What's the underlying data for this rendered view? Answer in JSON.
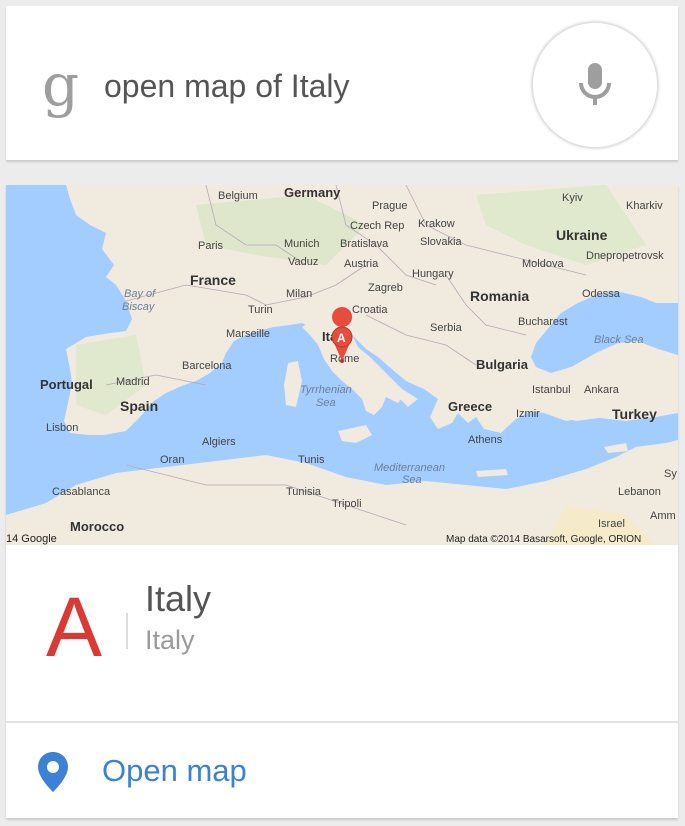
{
  "search": {
    "logo_letter": "g",
    "query": "open map of Italy",
    "mic_icon": "microphone-icon"
  },
  "map": {
    "labels": {
      "germany": "Germany",
      "belgium": "Belgium",
      "prague": "Prague",
      "kyiv": "Kyiv",
      "kharkiv": "Kharkiv",
      "czech_rep": "Czech Rep",
      "krakow": "Krakow",
      "paris": "Paris",
      "munich": "Munich",
      "bratislava": "Bratislava",
      "slovakia": "Slovakia",
      "ukraine": "Ukraine",
      "france": "France",
      "vaduz": "Vaduz",
      "austria": "Austria",
      "moldova": "Moldova",
      "dnepropetrovsk": "Dnepropetrovsk",
      "hungary": "Hungary",
      "bay_of_biscay": "Bay of\nBiscay",
      "milan": "Milan",
      "zagreb": "Zagreb",
      "romania": "Romania",
      "odessa": "Odessa",
      "turin": "Turin",
      "croatia": "Croatia",
      "bucharest": "Bucharest",
      "marseille": "Marseille",
      "serbia": "Serbia",
      "italy_label": "Ita",
      "black_sea": "Black Sea",
      "rome": "Rome",
      "portugal": "Portugal",
      "madrid": "Madrid",
      "barcelona": "Barcelona",
      "bulgaria": "Bulgaria",
      "tyrrhenian_sea": "Tyrrhenian\nSea",
      "istanbul": "Istanbul",
      "ankara": "Ankara",
      "spain": "Spain",
      "greece": "Greece",
      "izmir": "Izmir",
      "turkey": "Turkey",
      "lisbon": "Lisbon",
      "algiers": "Algiers",
      "athens": "Athens",
      "oran": "Oran",
      "tunis": "Tunis",
      "mediterranean_sea": "Mediterranean\nSea",
      "sy": "Sy",
      "casablanca": "Casablanca",
      "tunisia": "Tunisia",
      "lebanon": "Lebanon",
      "tripoli": "Tripoli",
      "amm": "Amm",
      "morocco": "Morocco",
      "israel": "Israel",
      "google": "14 Google",
      "attribution": "Map data ©2014 Basarsoft, Google, ORION"
    },
    "marker_letter": "A"
  },
  "place": {
    "letter": "A",
    "title": "Italy",
    "subtitle": "Italy"
  },
  "action": {
    "label": "Open map",
    "icon": "map-pin-icon"
  },
  "colors": {
    "water": "#a3ccff",
    "land": "#f0eadf",
    "marker": "#e74c3c",
    "accent": "#3b82d6",
    "letter": "#db3a34"
  }
}
